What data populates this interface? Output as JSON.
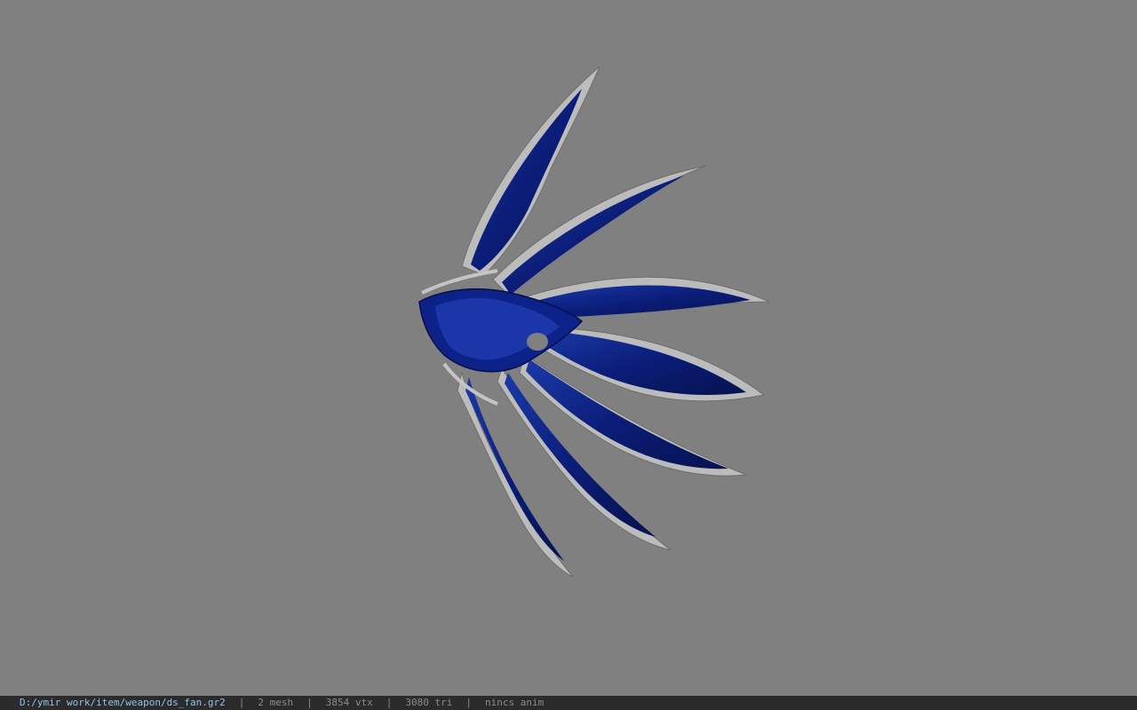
{
  "viewer": {
    "background_color": "#808080",
    "model": {
      "icon": "weapon-fan-model",
      "primary_color": "#0d1f7a",
      "edge_color": "#b9b9b9"
    }
  },
  "status_bar": {
    "file_path": "D:/ymir work/item/weapon/ds_fan.gr2",
    "separator": "|",
    "mesh_count": "2 mesh",
    "vertex_count": "3854 vtx",
    "triangle_count": "3080 tri",
    "animation": "nincs anim",
    "path_color": "#8fc4e8",
    "text_color": "#8c8c8c",
    "background_color": "#2b2b2b"
  }
}
